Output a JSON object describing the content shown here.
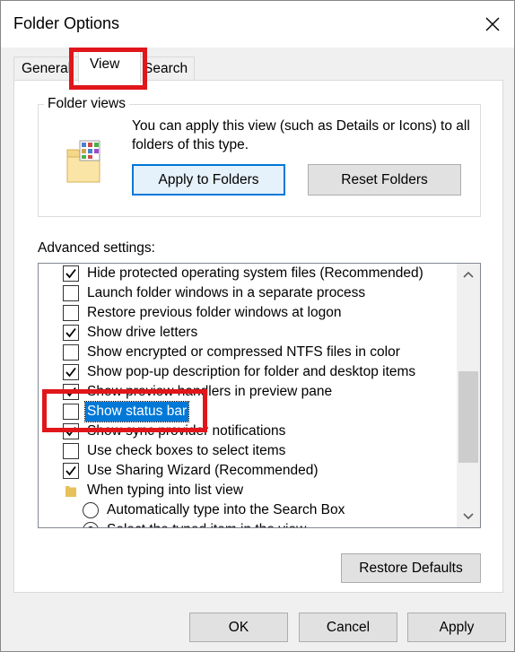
{
  "window": {
    "title": "Folder Options"
  },
  "tabs": [
    {
      "label": "General"
    },
    {
      "label": "View"
    },
    {
      "label": "Search"
    }
  ],
  "folder_views": {
    "legend": "Folder views",
    "description": "You can apply this view (such as Details or Icons) to all folders of this type.",
    "apply_label": "Apply to Folders",
    "reset_label": "Reset Folders"
  },
  "advanced": {
    "label": "Advanced settings:",
    "items": [
      {
        "label": "Hide protected operating system files (Recommended)",
        "type": "checkbox",
        "checked": true
      },
      {
        "label": "Launch folder windows in a separate process",
        "type": "checkbox",
        "checked": false
      },
      {
        "label": "Restore previous folder windows at logon",
        "type": "checkbox",
        "checked": false
      },
      {
        "label": "Show drive letters",
        "type": "checkbox",
        "checked": true
      },
      {
        "label": "Show encrypted or compressed NTFS files in color",
        "type": "checkbox",
        "checked": false
      },
      {
        "label": "Show pop-up description for folder and desktop items",
        "type": "checkbox",
        "checked": true
      },
      {
        "label": "Show preview handlers in preview pane",
        "type": "checkbox",
        "checked": true
      },
      {
        "label": "Show status bar",
        "type": "checkbox",
        "checked": false,
        "selected": true
      },
      {
        "label": "Show sync provider notifications",
        "type": "checkbox",
        "checked": true
      },
      {
        "label": "Use check boxes to select items",
        "type": "checkbox",
        "checked": false
      },
      {
        "label": "Use Sharing Wizard (Recommended)",
        "type": "checkbox",
        "checked": true
      },
      {
        "label": "When typing into list view",
        "type": "folder"
      },
      {
        "label": "Automatically type into the Search Box",
        "type": "radio",
        "checked": false
      },
      {
        "label": "Select the typed item in the view",
        "type": "radio",
        "checked": true
      }
    ]
  },
  "restore_defaults_label": "Restore Defaults",
  "footer": {
    "ok_label": "OK",
    "cancel_label": "Cancel",
    "apply_label": "Apply"
  },
  "colors": {
    "selection": "#0078d7",
    "highlight": "#e0161b"
  }
}
